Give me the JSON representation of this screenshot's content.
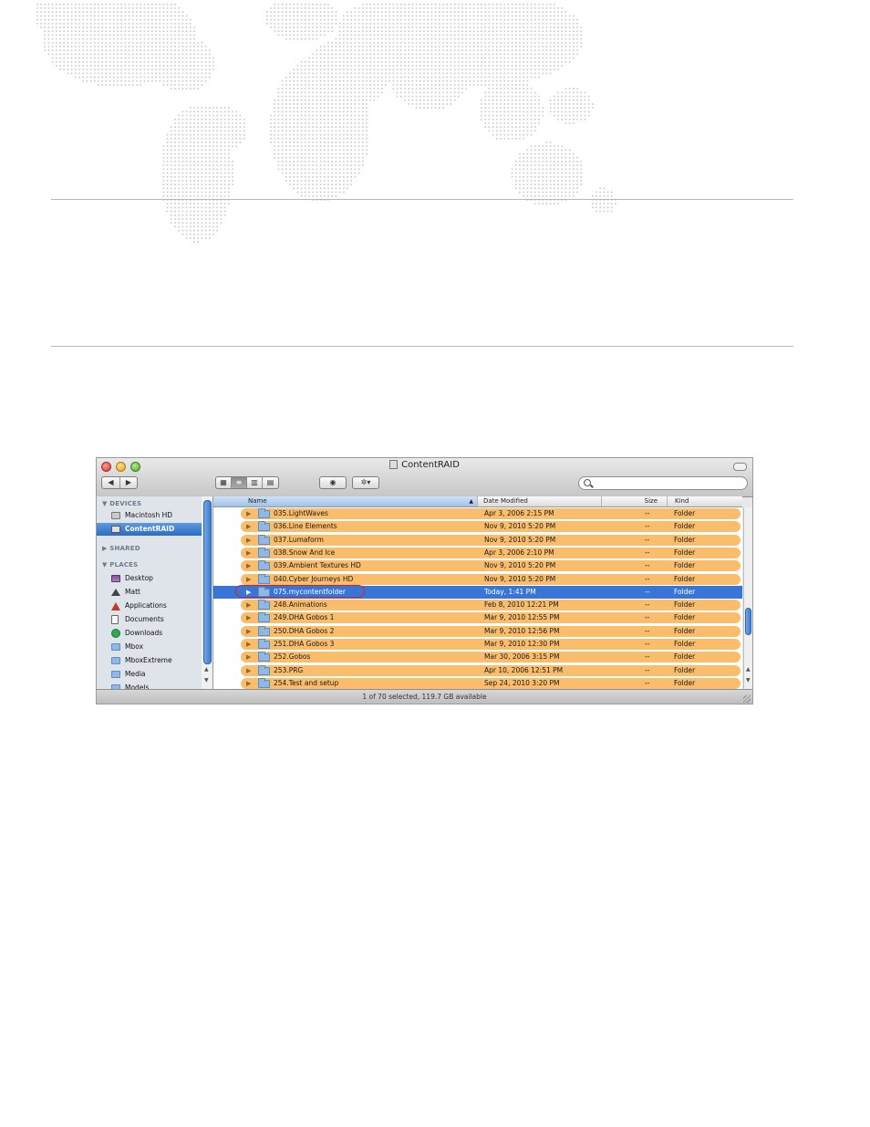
{
  "window": {
    "title": "ContentRAID",
    "status": "1 of 70 selected, 119.7 GB available"
  },
  "toolbar": {
    "back_label": "◀",
    "forward_label": "▶",
    "view_icons": "icon-view-icon",
    "view_list": "list-view-icon",
    "view_columns": "column-view-icon",
    "view_coverflow": "coverflow-view-icon",
    "quicklook": "eye-icon",
    "action": "gear-icon",
    "search_placeholder": ""
  },
  "sidebar": {
    "devices_label": "DEVICES",
    "shared_label": "SHARED",
    "places_label": "PLACES",
    "devices": [
      {
        "label": "Macintosh HD",
        "icon": "harddisk-icon"
      },
      {
        "label": "ContentRAID",
        "icon": "harddisk-icon"
      }
    ],
    "places": [
      {
        "label": "Desktop",
        "icon": "desktop-icon"
      },
      {
        "label": "Matt",
        "icon": "home-icon"
      },
      {
        "label": "Applications",
        "icon": "applications-icon"
      },
      {
        "label": "Documents",
        "icon": "documents-icon"
      },
      {
        "label": "Downloads",
        "icon": "downloads-icon"
      },
      {
        "label": "Mbox",
        "icon": "folder-icon"
      },
      {
        "label": "MboxExtreme",
        "icon": "folder-icon"
      },
      {
        "label": "Media",
        "icon": "folder-icon"
      },
      {
        "label": "Models",
        "icon": "folder-icon"
      }
    ]
  },
  "columns": {
    "name": "Name",
    "date": "Date Modified",
    "size": "Size",
    "kind": "Kind"
  },
  "rows": [
    {
      "name": "035.LightWaves",
      "date": "Apr 3, 2006 2:15 PM",
      "size": "--",
      "kind": "Folder"
    },
    {
      "name": "036.Line Elements",
      "date": "Nov 9, 2010 5:20 PM",
      "size": "--",
      "kind": "Folder"
    },
    {
      "name": "037.Lumaform",
      "date": "Nov 9, 2010 5:20 PM",
      "size": "--",
      "kind": "Folder"
    },
    {
      "name": "038.Snow And Ice",
      "date": "Apr 3, 2006 2:10 PM",
      "size": "--",
      "kind": "Folder"
    },
    {
      "name": "039.Ambient Textures HD",
      "date": "Nov 9, 2010 5:20 PM",
      "size": "--",
      "kind": "Folder"
    },
    {
      "name": "040.Cyber Journeys HD",
      "date": "Nov 9, 2010 5:20 PM",
      "size": "--",
      "kind": "Folder"
    },
    {
      "name": "075.mycontentfolder",
      "date": "Today, 1:41 PM",
      "size": "--",
      "kind": "Folder"
    },
    {
      "name": "248.Animations",
      "date": "Feb 8, 2010 12:21 PM",
      "size": "--",
      "kind": "Folder"
    },
    {
      "name": "249.DHA Gobos 1",
      "date": "Mar 9, 2010 12:55 PM",
      "size": "--",
      "kind": "Folder"
    },
    {
      "name": "250.DHA Gobos 2",
      "date": "Mar 9, 2010 12:56 PM",
      "size": "--",
      "kind": "Folder"
    },
    {
      "name": "251.DHA Gobos 3",
      "date": "Mar 9, 2010 12:30 PM",
      "size": "--",
      "kind": "Folder"
    },
    {
      "name": "252.Gobos",
      "date": "Mar 30, 2006 3:15 PM",
      "size": "--",
      "kind": "Folder"
    },
    {
      "name": "253.PRG",
      "date": "Apr 10, 2006 12:51 PM",
      "size": "--",
      "kind": "Folder"
    },
    {
      "name": "254.Test and setup",
      "date": "Sep 24, 2010 3:20 PM",
      "size": "--",
      "kind": "Folder"
    }
  ],
  "selected_row": 6,
  "colors": {
    "label_orange": "#f9bd6c",
    "selection_blue": "#3875d7",
    "annotation_red": "#d9202a",
    "map_dot": "#c8c8c8"
  }
}
